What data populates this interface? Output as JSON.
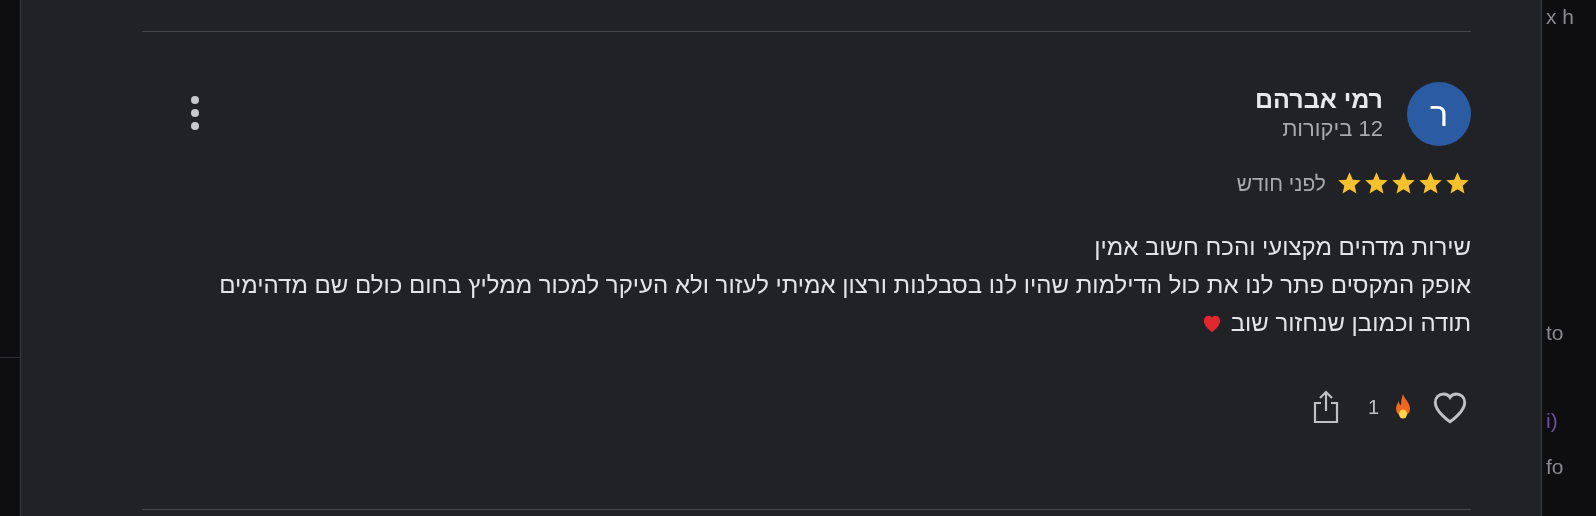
{
  "background_edge": [
    {
      "text": "x h",
      "color": "#8a8a8e"
    },
    {
      "text": "to",
      "color": "#8a8a8e"
    },
    {
      "text": "i)",
      "color": "#6b4fa0"
    },
    {
      "text": "fo",
      "color": "#8a8a8e"
    }
  ],
  "review": {
    "avatar_letter": "ר",
    "author": "רמי אברהם",
    "review_count": "12 ביקורות",
    "stars": 5,
    "date": "לפני חודש",
    "lines": [
      "שירות מדהים מקצועי והכח חשוב אמין",
      "אופק המקסים פתר לנו את כול הדילמות שהיו לנו בסבלנות ורצון אמיתי לעזור ולא העיקר למכור ממליץ בחום כולם שם מדהימים",
      "תודה וכמובן שנחזור שוב"
    ],
    "reaction_count": "1"
  }
}
